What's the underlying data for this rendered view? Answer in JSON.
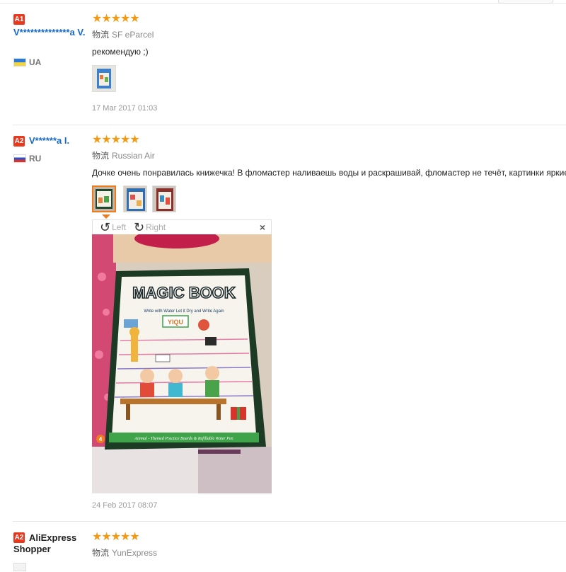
{
  "reviews": [
    {
      "badge": "A1",
      "name": "V**************a V.",
      "country": "UA",
      "stars": "★★★★★",
      "logistics_glyph": "物流",
      "logistics": "SF eParcel",
      "text": "рекомендую ;)",
      "date": "17 Mar 2017 01:03"
    },
    {
      "badge": "A2",
      "name": "V******a I.",
      "country": "RU",
      "stars": "★★★★★",
      "logistics_glyph": "物流",
      "logistics": "Russian Air",
      "text": "Дочке очень понравилась книжечка! В фломастер наливаешь воды и раскрашивай, фломастер не течёт, картинки яркие",
      "date": "24 Feb 2017 08:07"
    },
    {
      "badge": "A2",
      "name": "AliExpress Shopper",
      "stars": "★★★★★",
      "logistics_glyph": "物流",
      "logistics": "YunExpress"
    }
  ],
  "viewer": {
    "rotate_left_label": "Left",
    "rotate_right_label": "Right",
    "close_label": "×",
    "rotate_left_symbol": "↺",
    "rotate_right_symbol": "↻",
    "photo": {
      "book_title": "MAGIC BOOK",
      "book_subtitle": "Write with Water Let it Dry and Write Again",
      "brand": "YIQU",
      "bottom_number": "4",
      "bottom_text": "Animal - Themed Practice Boards & Refillable Water Pen"
    }
  },
  "colors": {
    "accent": "#e8391f",
    "star": "#f29a14",
    "link": "#1769c8",
    "active_thumb": "#f07a1c"
  }
}
